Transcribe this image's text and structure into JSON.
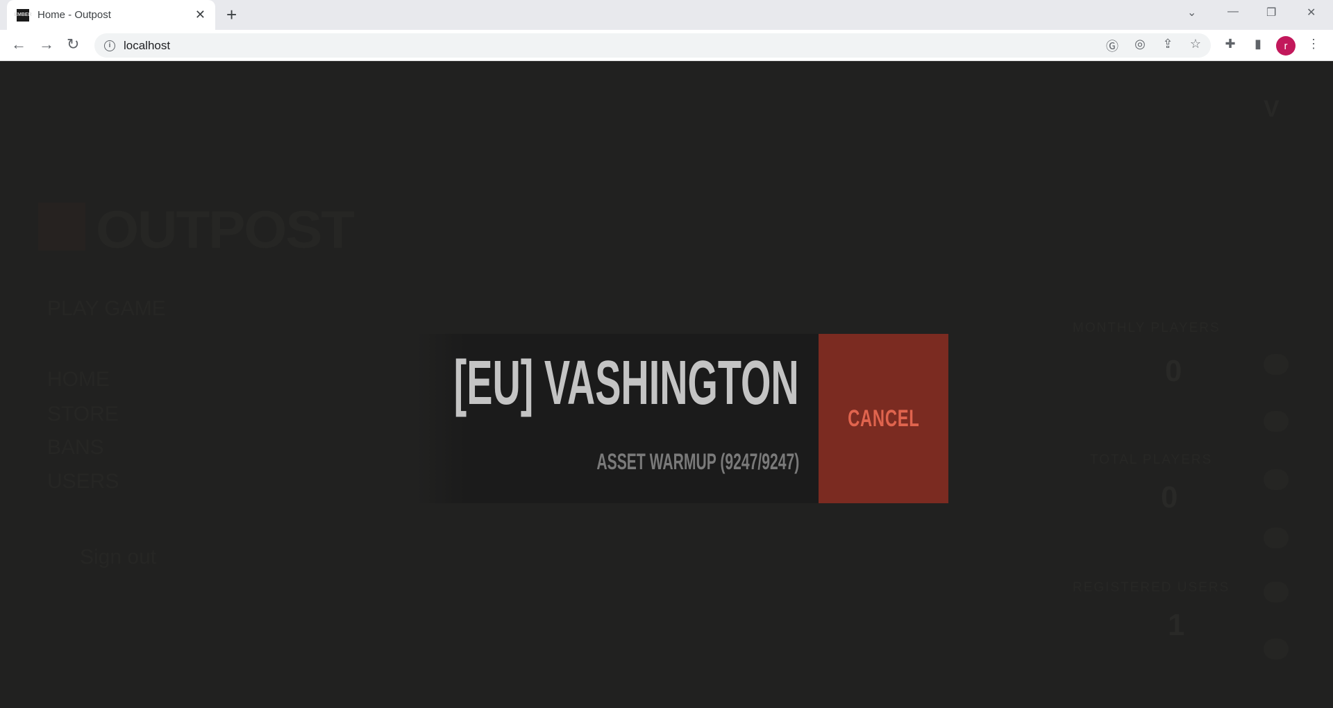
{
  "browser": {
    "tab_title": "Home - Outpost",
    "favicon_text": "EMBER",
    "url": "localhost",
    "profile_initial": "r"
  },
  "background": {
    "logo": "OUTPOST",
    "play_game": "PLAY GAME",
    "nav": [
      "HOME",
      "STORE",
      "BANS",
      "USERS"
    ],
    "sign_out": "Sign out",
    "stats": [
      {
        "label": "MONTHLY PLAYERS",
        "value": "0"
      },
      {
        "label": "TOTAL PLAYERS",
        "value": "0"
      },
      {
        "label": "REGISTERED USERS",
        "value": "1"
      }
    ]
  },
  "dialog": {
    "server_name": "[EU] VASHINGTON",
    "status": "ASSET WARMUP (9247/9247)",
    "cancel_label": "CANCEL"
  },
  "colors": {
    "cancel_bg": "#7b2b21",
    "cancel_text": "#e0644e",
    "page_bg": "#212120",
    "avatar": "#c2185b"
  }
}
